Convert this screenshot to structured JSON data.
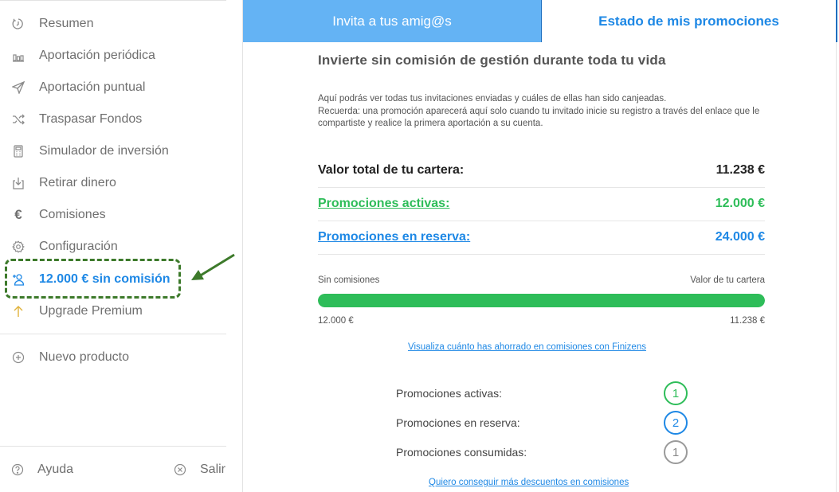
{
  "sidebar": {
    "items": [
      {
        "label": "Resumen",
        "icon": "clock-icon"
      },
      {
        "label": "Aportación periódica",
        "icon": "bar-chart-icon"
      },
      {
        "label": "Aportación puntual",
        "icon": "send-icon"
      },
      {
        "label": "Traspasar Fondos",
        "icon": "shuffle-icon"
      },
      {
        "label": "Simulador de inversión",
        "icon": "calculator-icon"
      },
      {
        "label": "Retirar dinero",
        "icon": "withdraw-icon"
      },
      {
        "label": "Comisiones",
        "icon": "euro-icon"
      },
      {
        "label": "Configuración",
        "icon": "gear-icon"
      },
      {
        "label": "12.000 € sin comisión",
        "icon": "add-user-icon"
      },
      {
        "label": "Upgrade Premium",
        "icon": "arrow-up-icon"
      }
    ],
    "new_product": "Nuevo producto",
    "help": "Ayuda",
    "logout": "Salir"
  },
  "tabs": {
    "invite": "Invita a tus amig@s",
    "status": "Estado de mis promociones"
  },
  "main": {
    "title": "Invierte sin comisión de gestión durante toda tu vida",
    "intro_line1": "Aquí podrás ver todas tus invitaciones enviadas y cuáles de ellas han sido canjeadas.",
    "intro_line2": "Recuerda: una promoción aparecerá aquí solo cuando tu invitado inicie su registro a través del enlace que le compartiste y realice la primera aportación a su cuenta.",
    "portfolio_label": "Valor total de tu cartera:",
    "portfolio_value": "11.238 €",
    "active_label": "Promociones activas:",
    "active_value": "12.000 €",
    "reserve_label": "Promociones en reserva:",
    "reserve_value": "24.000 €",
    "bar_left_label": "Sin comisiones",
    "bar_right_label": "Valor de tu cartera",
    "bar_left_value": "12.000 €",
    "bar_right_value": "11.238 €",
    "progress_fraction": 1.0,
    "savings_link": "Visualiza cuánto has ahorrado en comisiones con Finizens",
    "counts": [
      {
        "label": "Promociones activas:",
        "value": "1",
        "color": "#2ebd59"
      },
      {
        "label": "Promociones en reserva:",
        "value": "2",
        "color": "#1e88e5"
      },
      {
        "label": "Promociones consumidas:",
        "value": "1",
        "color": "#9a9a9a"
      }
    ],
    "more_link": "Quiero conseguir más descuentos en comisiones"
  },
  "colors": {
    "accent": "#1e88e5",
    "tab_bg": "#64b3f4",
    "green": "#2ebd59",
    "annotation": "#3d7a2b"
  }
}
